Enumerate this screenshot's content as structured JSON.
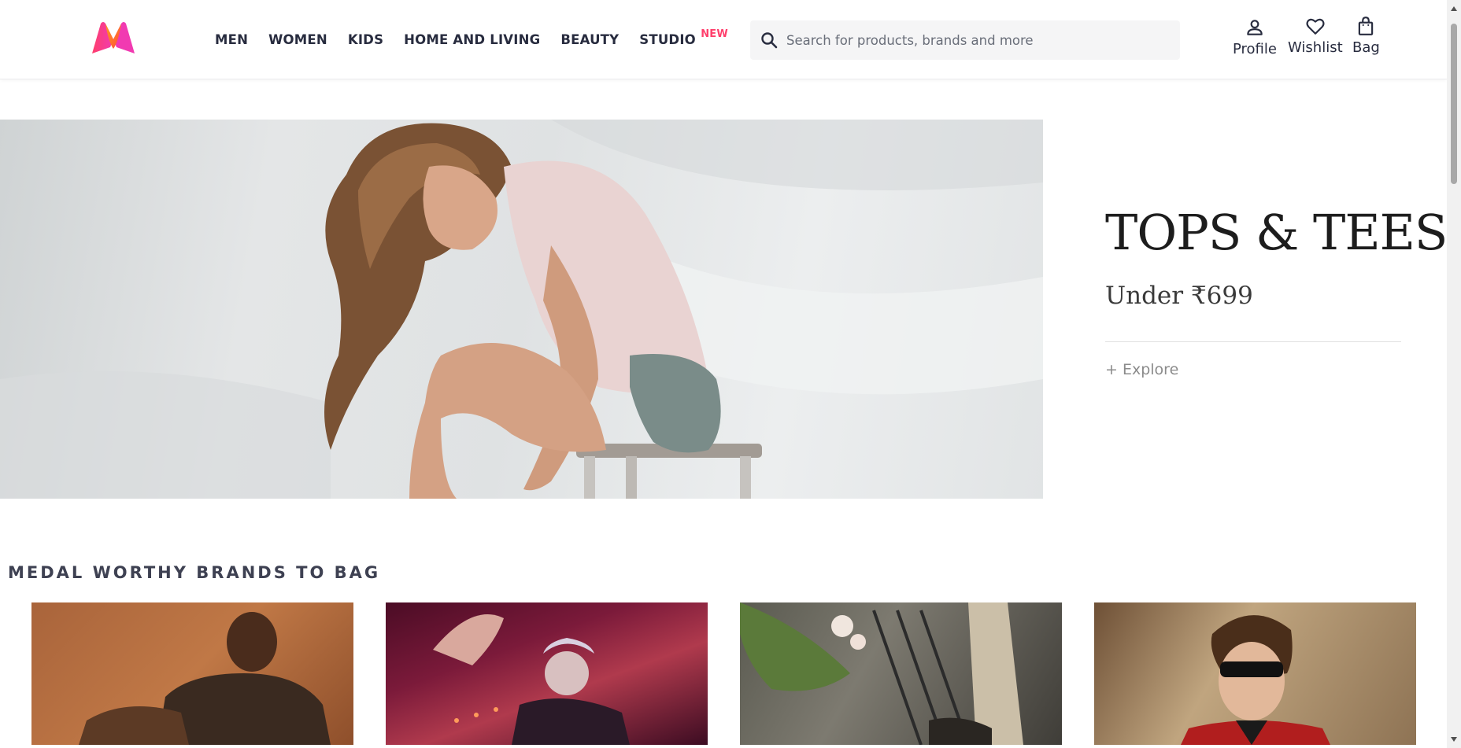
{
  "header": {
    "logo_icon": "myntra-logo-icon",
    "nav": [
      {
        "label": "MEN"
      },
      {
        "label": "WOMEN"
      },
      {
        "label": "KIDS"
      },
      {
        "label": "HOME AND LIVING"
      },
      {
        "label": "BEAUTY"
      },
      {
        "label": "STUDIO",
        "badge": "NEW"
      }
    ],
    "search": {
      "placeholder": "Search for products, brands and more",
      "value": ""
    },
    "actions": {
      "profile": "Profile",
      "wishlist": "Wishlist",
      "bag": "Bag"
    }
  },
  "hero": {
    "title": "TOPS & TEES",
    "subtitle": "Under ₹699",
    "cta": "+ Explore"
  },
  "brands_section": {
    "title": "MEDAL WORTHY BRANDS TO BAG",
    "cards": [
      {
        "icon": "brand-card-image-1"
      },
      {
        "icon": "brand-card-image-2"
      },
      {
        "icon": "brand-card-image-3"
      },
      {
        "icon": "brand-card-image-4"
      }
    ]
  },
  "colors": {
    "accent": "#ff3f6c",
    "text": "#282c3f",
    "search_bg": "#f5f5f6"
  }
}
